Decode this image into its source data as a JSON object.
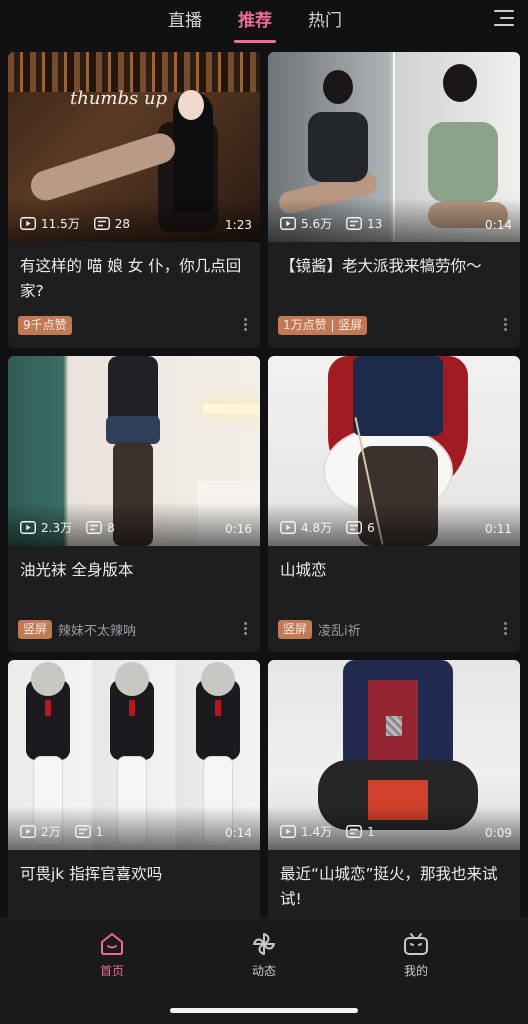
{
  "header": {
    "tabs": [
      {
        "label": "直播",
        "active": false
      },
      {
        "label": "推荐",
        "active": true
      },
      {
        "label": "热门",
        "active": false
      }
    ],
    "menu_icon": "hamburger-menu-icon",
    "accent_color": "#ef6b99"
  },
  "feed": {
    "cards": [
      {
        "plays": "11.5万",
        "comments": "28",
        "duration": "1:23",
        "title": "有这样的 喵 娘 女 仆，你几点回家?",
        "badge": "9千点赞",
        "author": "",
        "overlay_text": "thumbs up"
      },
      {
        "plays": "5.6万",
        "comments": "13",
        "duration": "0:14",
        "title": "【镜酱】老大派我来犒劳你～",
        "badge": "1万点赞 | 竖屏",
        "author": ""
      },
      {
        "plays": "2.3万",
        "comments": "8",
        "duration": "0:16",
        "title": "油光袜 全身版本",
        "badge": "竖屏",
        "author": "辣妹不太辣呐"
      },
      {
        "plays": "4.8万",
        "comments": "6",
        "duration": "0:11",
        "title": "山城恋",
        "badge": "竖屏",
        "author": "凌乱i祈"
      },
      {
        "plays": "2万",
        "comments": "1",
        "duration": "0:14",
        "title": "可畏jk 指挥官喜欢吗",
        "badge": "",
        "author": ""
      },
      {
        "plays": "1.4万",
        "comments": "1",
        "duration": "0:09",
        "title": "最近“山城恋”挺火，那我也来试试!",
        "badge": "",
        "author": ""
      }
    ]
  },
  "bottom_nav": {
    "items": [
      {
        "label": "首页",
        "icon": "home-tv-icon",
        "active": true
      },
      {
        "label": "动态",
        "icon": "pinwheel-icon",
        "active": false
      },
      {
        "label": "我的",
        "icon": "tv-face-icon",
        "active": false
      }
    ]
  },
  "colors": {
    "background": "#111113",
    "card": "#1e1e21",
    "badge": "#c27a55",
    "accent": "#ef6b99"
  }
}
